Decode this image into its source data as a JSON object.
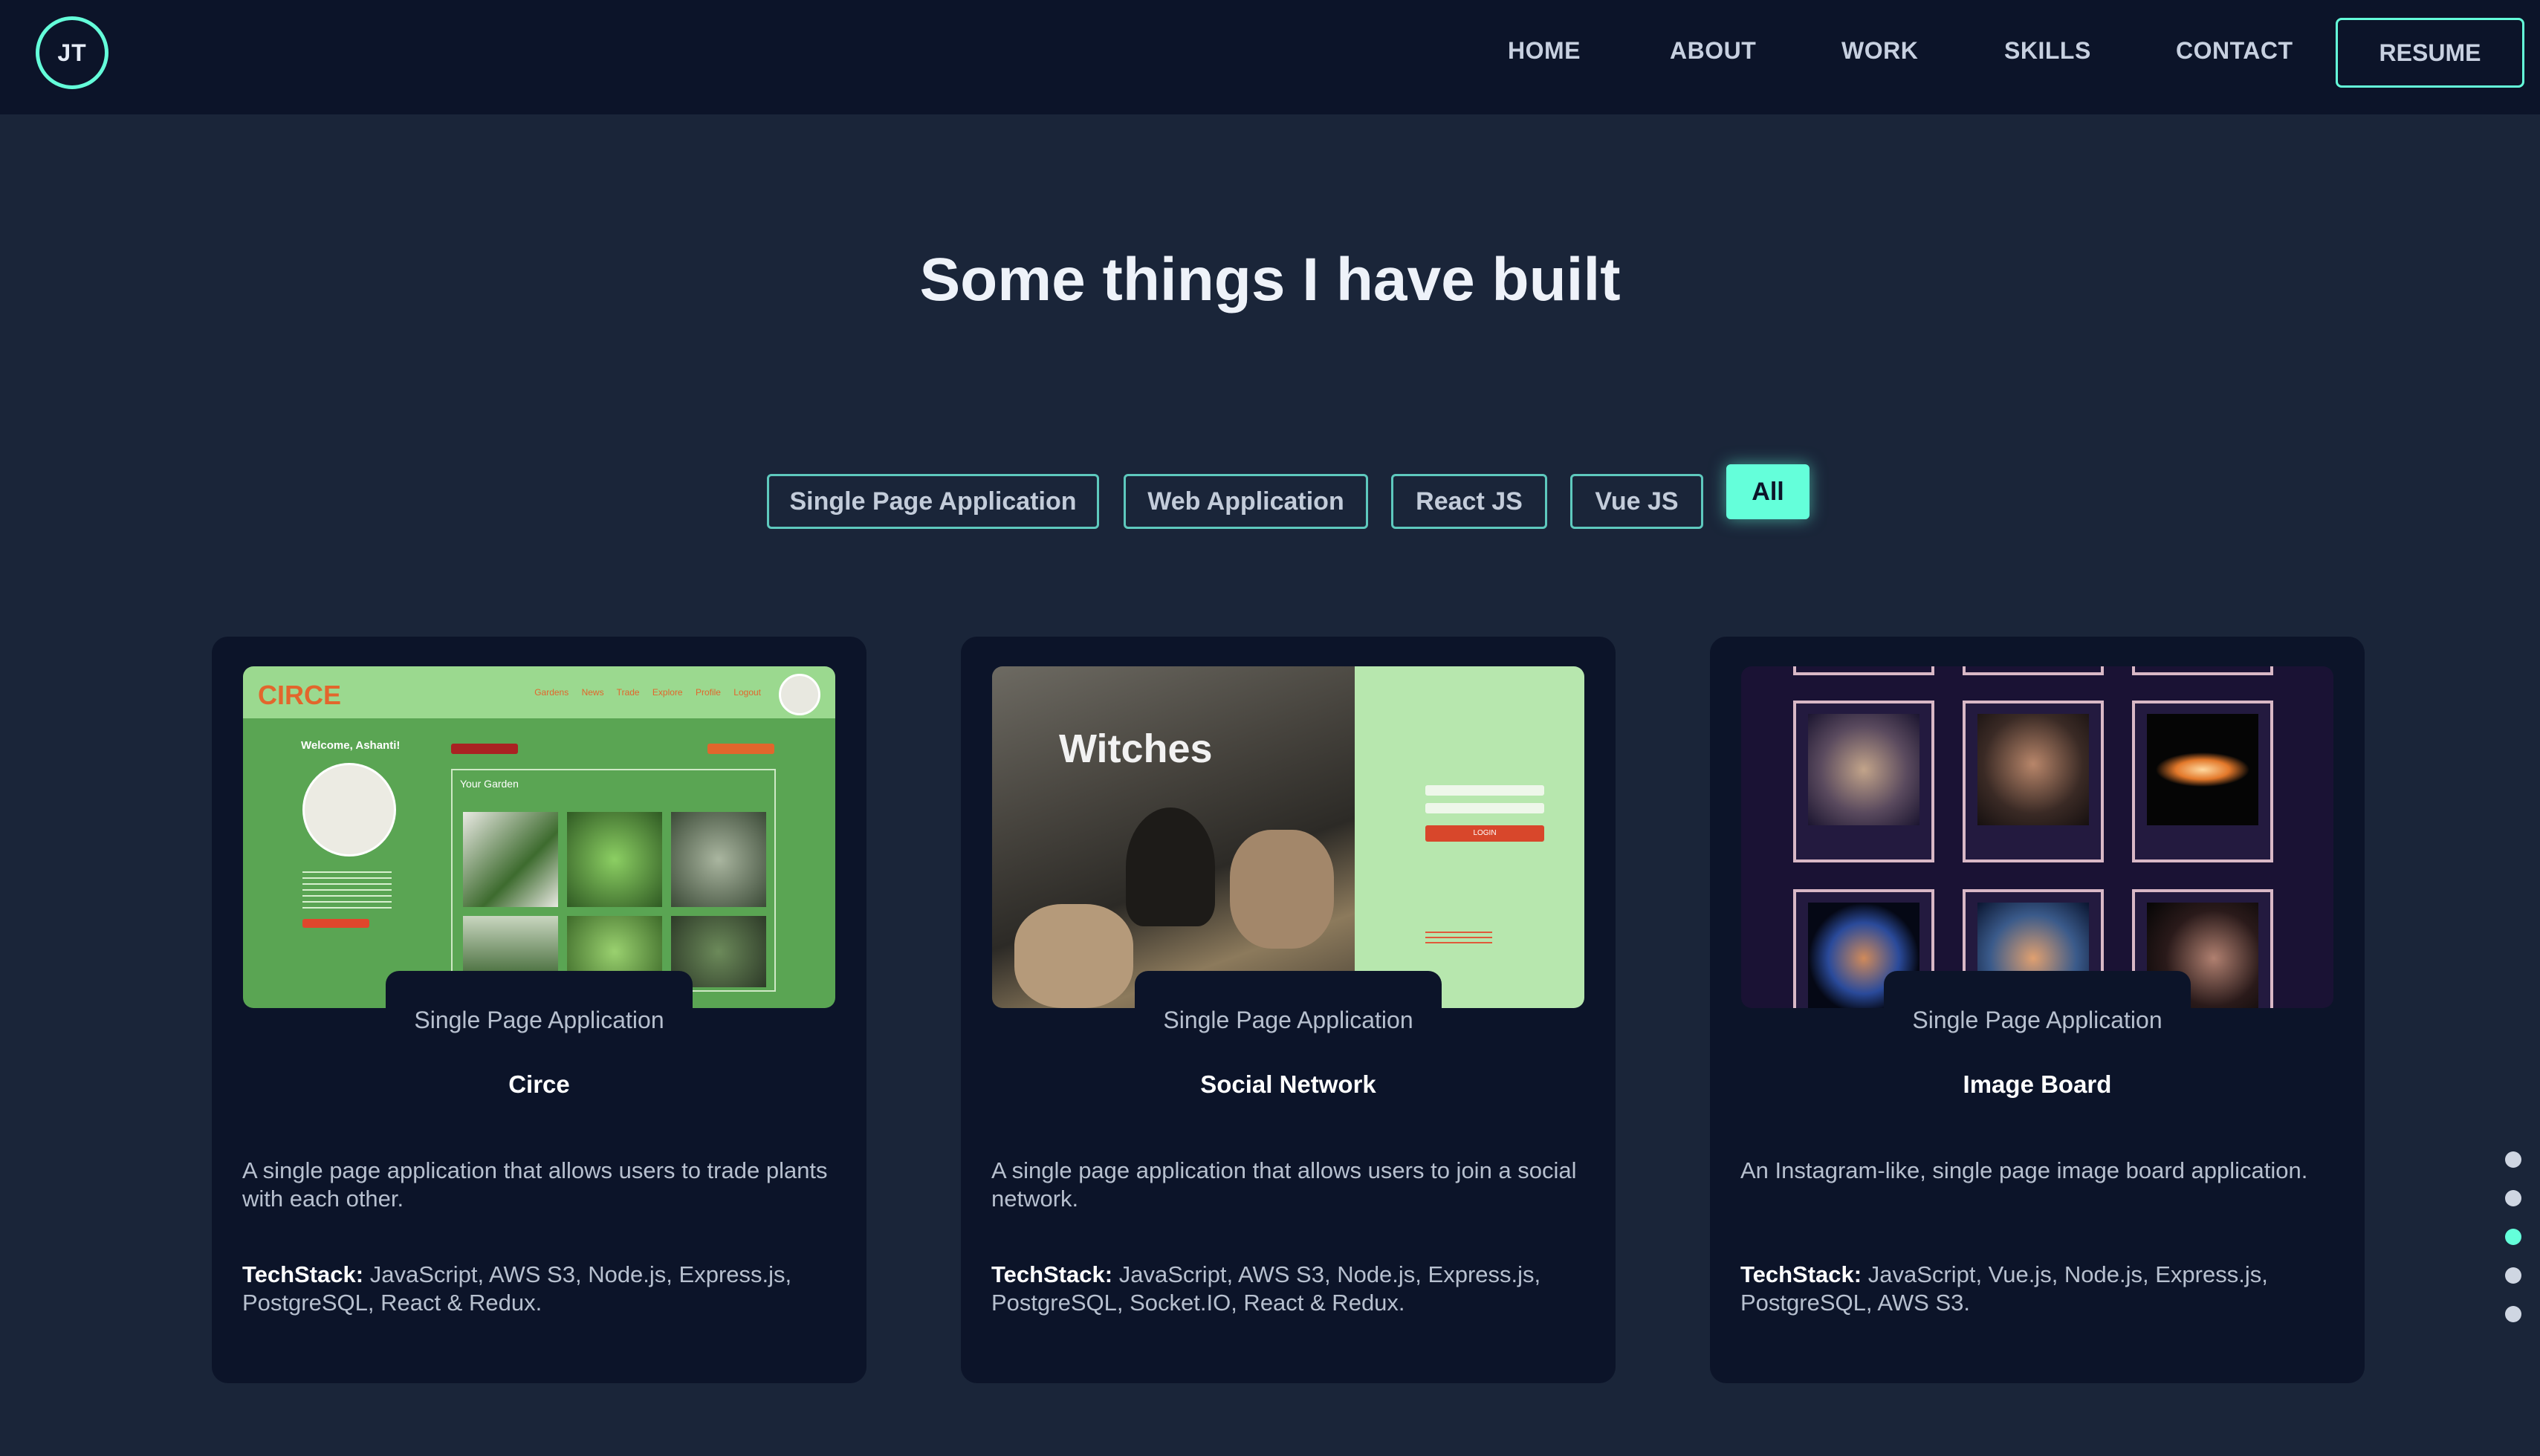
{
  "header": {
    "logo": "JT",
    "nav": [
      "HOME",
      "ABOUT",
      "WORK",
      "SKILLS",
      "CONTACT"
    ],
    "resume": "RESUME"
  },
  "section": {
    "title": "Some things I have built"
  },
  "filters": [
    {
      "label": "Single Page Application",
      "active": false
    },
    {
      "label": "Web Application",
      "active": false
    },
    {
      "label": "React JS",
      "active": false
    },
    {
      "label": "Vue JS",
      "active": false
    },
    {
      "label": "All",
      "active": true
    }
  ],
  "projects": [
    {
      "category": "Single Page Application",
      "title": "Circe",
      "description": "A single page application that allows users to trade plants with each other.",
      "tech_label": "TechStack:",
      "tech": "JavaScript, AWS S3, Node.js, Express.js, PostgreSQL, React & Redux.",
      "thumb": {
        "logo": "CIRCE",
        "nav": "Gardens News Trade Explore Profile Logout",
        "welcome": "Welcome, Ashanti!",
        "panel": "Your Garden"
      }
    },
    {
      "category": "Single Page Application",
      "title": "Social Network",
      "description": "A single page application that allows users to join a social network.",
      "tech_label": "TechStack:",
      "tech": "JavaScript, AWS S3, Node.js, Express.js, PostgreSQL, Socket.IO, React & Redux.",
      "thumb": {
        "text": "Witches",
        "login": "LOGIN"
      }
    },
    {
      "category": "Single Page Application",
      "title": "Image Board",
      "description": "An Instagram-like, single page image board application.",
      "tech_label": "TechStack:",
      "tech": "JavaScript, Vue.js, Node.js, Express.js, PostgreSQL, AWS S3."
    }
  ],
  "side_nav": {
    "count": 5,
    "active_index": 2
  },
  "colors": {
    "accent": "#64ffda",
    "background": "#1a2539",
    "header": "#0c1429"
  }
}
